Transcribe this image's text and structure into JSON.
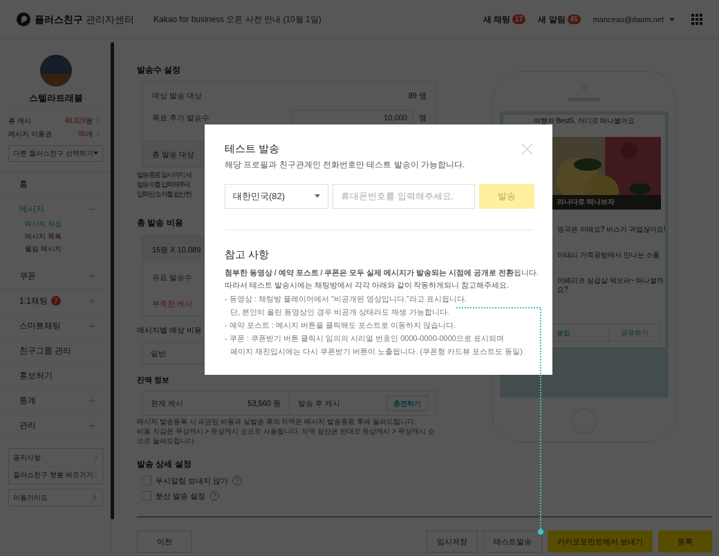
{
  "header": {
    "brand": "플러스친구",
    "brand_suffix": "관리자센터",
    "notice": "Kakao for business 오픈 사전 안내 (10월 1일)",
    "counters": [
      {
        "label": "새 채팅",
        "count": "17"
      },
      {
        "label": "새 알림",
        "count": "45"
      }
    ],
    "account": "manceau@daum.net"
  },
  "sidebar": {
    "profile_name": "스텔라트래블",
    "stats": [
      {
        "label": "총 캐시",
        "value": "48,829",
        "unit": "원"
      },
      {
        "label": "메시지 이용권",
        "value": "98",
        "unit": "개"
      }
    ],
    "friend_select": "다른 플러스친구 선택하기",
    "nav": [
      {
        "label": "홈",
        "selected": false
      },
      {
        "label": "메시지",
        "selected": true,
        "expanded": true,
        "children": [
          {
            "label": "메시지 작성",
            "selected": true
          },
          {
            "label": "메시지 목록",
            "selected": false
          },
          {
            "label": "웰컴 메시지",
            "selected": false
          }
        ]
      },
      {
        "label": "쿠폰",
        "selected": false,
        "expanded": false
      },
      {
        "label": "1:1채팅",
        "selected": false,
        "expanded": false,
        "badge": "7"
      },
      {
        "label": "스마트채팅",
        "selected": false,
        "expanded": false
      },
      {
        "label": "친구그룹 관리",
        "selected": false
      },
      {
        "label": "홍보하기",
        "selected": false
      },
      {
        "label": "통계",
        "selected": false,
        "expanded": false
      },
      {
        "label": "관리",
        "selected": false,
        "expanded": false
      }
    ],
    "links": [
      "공지사항",
      "플러스친구 챗봇 바로가기"
    ],
    "guide": "이용가이드"
  },
  "send_count": {
    "title": "발송수 설정",
    "expected_label": "예상 발송 대상",
    "expected_value": "89",
    "expected_unit": "명",
    "target_label": "목표 추가 발송수",
    "target_value": "10,000",
    "target_unit": "명",
    "total_label": "총 발송 대상",
    "notes": [
      "발송종료 일시까지 세",
      "발송수를 입력해주세",
      "입력된 숫자를 합산한"
    ]
  },
  "cost": {
    "title": "총 발송 비용",
    "formula": "15원 X 10,089",
    "paid_label": "유료 발송수",
    "shortage_label": "부족한 캐시",
    "per_message_title": "메시지별 예상 비용",
    "per_message_type": "일반"
  },
  "balance": {
    "title": "잔액 정보",
    "current_label": "현재 캐시",
    "current_value": "53,560",
    "current_unit": "원",
    "after_label": "발송 후 캐시",
    "charge_button": "충전하기",
    "notes": [
      "메시지 발송등록 시 과금된 비용과 실발송 후의 차액은 메시지 발송종료 후에 돌려드립니다.",
      "비용 차감은 무상캐시 > 유상캐시 순으로 사용됩니다. 차액 정산은 반대로 유상캐시 > 무상캐시 순으로 돌려드립니다."
    ]
  },
  "details": {
    "title": "발송 상세 설정",
    "options": [
      {
        "label": "푸시알림 보내지 않기",
        "checked": false
      },
      {
        "label": "분산 발송 설정",
        "checked": false
      }
    ]
  },
  "footer_buttons": [
    {
      "label": "이전",
      "kind": "outline"
    },
    {
      "label": "임시저장",
      "kind": "outline"
    },
    {
      "label": "테스트발송",
      "kind": "outline"
    },
    {
      "label": "카카오모먼트에서 보내기",
      "kind": "primary"
    },
    {
      "label": "등록",
      "kind": "primary"
    }
  ],
  "preview": {
    "title": "여행지 Best5, 어디로 떠나볼까요",
    "caption": "라나다로 떠나보자",
    "items": [
      "영국은 어때요? 버스가 귀엽잖아요!",
      "이태리 가죽공방에서 만나는 소품",
      "이베리코 삼겹살 먹으러~ 떠나볼까\n요?"
    ],
    "actions": [
      "클럽",
      "공유하기"
    ]
  },
  "modal": {
    "title": "테스트 발송",
    "subtitle": "해당 프로필과 친구관계인 전화번호만 테스트 발송이 가능합니다.",
    "country": "대한민국(82)",
    "phone_placeholder": "휴대폰번호를 입력해주세요.",
    "send_button": {
      "label": "발송",
      "disabled": true
    },
    "notes_title": "참고 사항",
    "notice": [
      "**첨부한 동영상 / 예약 포스트 / 쿠폰은 모두 실제 메시지가 발송되는 시점에 공개로 전환**됩니다.",
      "따라서 테스트 발송시에는 채팅방에서 각각 아래와 같이 작동하게되니 참고해주세요."
    ],
    "bullets": [
      {
        "lines": [
          "- 동영상 : 채팅방 플레이어에서 \"비공개된 영상입니다.\"라고 표시됩니다.",
          "단, 본인이 올린 동영상인 경우 비공개 상태라도 재생 가능합니다."
        ]
      },
      {
        "lines": [
          "- 예약 포스트 : 메시지 버튼을 클릭해도 포스트로 이동하지 않습니다."
        ]
      },
      {
        "lines": [
          "- 쿠폰 : 쿠폰받기 버튼 클릭시 임의의 시리얼 번호인 0000-0000-0000으로 표시되며",
          "페이지 재진입시에는 다시 쿠폰받기 버튼이 노출됩니다. (쿠폰형 카드뷰 포스트도 동일)"
        ]
      }
    ]
  }
}
